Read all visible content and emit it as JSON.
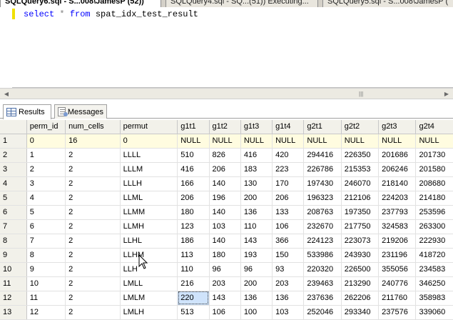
{
  "tabs": [
    {
      "label": "SQLQuery6.sql - S...008\\JamesP (52))",
      "active": true
    },
    {
      "label": "SQLQuery4.sql - SQ...(51)) Executing...",
      "active": false
    },
    {
      "label": "SQLQuery5.sql - S...008\\JamesP (",
      "active": false
    }
  ],
  "editor": {
    "keyword_select": "select",
    "star": "*",
    "keyword_from": "from",
    "table": "spat_idx_test_result"
  },
  "scrollbar": {
    "left_arrow": "◀",
    "right_arrow": "▶",
    "grip": "|||"
  },
  "result_tabs": {
    "results": "Results",
    "messages": "Messages"
  },
  "grid": {
    "columns": [
      "perm_id",
      "num_cells",
      "permut",
      "g1t1",
      "g1t2",
      "g1t3",
      "g1t4",
      "g2t1",
      "g2t2",
      "g2t3",
      "g2t4"
    ],
    "rows": [
      {
        "n": "1",
        "cells": [
          "0",
          "16",
          "0",
          "NULL",
          "NULL",
          "NULL",
          "NULL",
          "NULL",
          "NULL",
          "NULL",
          "NULL"
        ]
      },
      {
        "n": "2",
        "cells": [
          "1",
          "2",
          "LLLL",
          "510",
          "826",
          "416",
          "420",
          "294416",
          "226350",
          "201686",
          "201730"
        ]
      },
      {
        "n": "3",
        "cells": [
          "2",
          "2",
          "LLLM",
          "416",
          "206",
          "183",
          "223",
          "226786",
          "215353",
          "206246",
          "201580"
        ]
      },
      {
        "n": "4",
        "cells": [
          "3",
          "2",
          "LLLH",
          "166",
          "140",
          "130",
          "170",
          "197430",
          "246070",
          "218140",
          "208680"
        ]
      },
      {
        "n": "5",
        "cells": [
          "4",
          "2",
          "LLML",
          "206",
          "196",
          "200",
          "206",
          "196323",
          "212106",
          "224203",
          "214180"
        ]
      },
      {
        "n": "6",
        "cells": [
          "5",
          "2",
          "LLMM",
          "180",
          "140",
          "136",
          "133",
          "208763",
          "197350",
          "237793",
          "253596"
        ]
      },
      {
        "n": "7",
        "cells": [
          "6",
          "2",
          "LLMH",
          "123",
          "103",
          "110",
          "106",
          "232670",
          "217750",
          "324583",
          "263300"
        ]
      },
      {
        "n": "8",
        "cells": [
          "7",
          "2",
          "LLHL",
          "186",
          "140",
          "143",
          "366",
          "224123",
          "223073",
          "219206",
          "222930"
        ]
      },
      {
        "n": "9",
        "cells": [
          "8",
          "2",
          "LLHM",
          "113",
          "180",
          "193",
          "150",
          "533986",
          "243930",
          "231196",
          "418720"
        ]
      },
      {
        "n": "10",
        "cells": [
          "9",
          "2",
          "LLH",
          "110",
          "96",
          "96",
          "93",
          "220320",
          "226500",
          "355056",
          "234583"
        ]
      },
      {
        "n": "11",
        "cells": [
          "10",
          "2",
          "LMLL",
          "216",
          "203",
          "200",
          "203",
          "239463",
          "213290",
          "240776",
          "346250"
        ]
      },
      {
        "n": "12",
        "cells": [
          "11",
          "2",
          "LMLM",
          "220",
          "143",
          "136",
          "136",
          "237636",
          "262206",
          "211760",
          "358983"
        ]
      },
      {
        "n": "13",
        "cells": [
          "12",
          "2",
          "LMLH",
          "513",
          "106",
          "100",
          "103",
          "252046",
          "293340",
          "237576",
          "339060"
        ]
      }
    ]
  }
}
